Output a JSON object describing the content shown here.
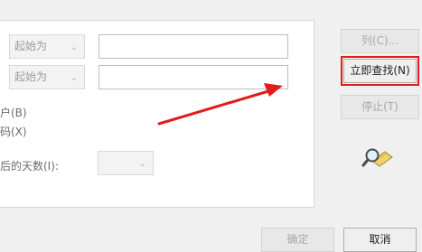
{
  "criteria": {
    "row1_select": "起始为",
    "row2_select": "起始为",
    "row1_value": "",
    "row2_value": "",
    "option_disabled_accounts": "户(B)",
    "option_no_expire_password": "码(X)",
    "days_since_logon_label": "后的天数(I):",
    "days_select": ""
  },
  "actions": {
    "columns_label": "列(C)...",
    "find_now_label": "立即查找(N)",
    "stop_label": "停止(T)"
  },
  "footer": {
    "ok_label": "确定",
    "cancel_label": "取消"
  },
  "icons": {
    "search": "search-magnifier-icon",
    "chevron": "chevron-down-icon"
  },
  "colors": {
    "annotation_red": "#e21b1b"
  }
}
